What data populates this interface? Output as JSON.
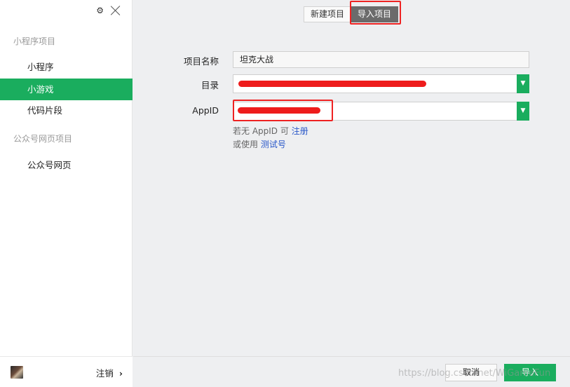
{
  "sidebar": {
    "sections": [
      {
        "label": "小程序项目",
        "items": [
          "小程序",
          "小游戏",
          "代码片段"
        ]
      },
      {
        "label": "公众号网页项目",
        "items": [
          "公众号网页"
        ]
      }
    ],
    "active_item": "小游戏",
    "footer": {
      "logout_label": "注销",
      "chevron": "›"
    }
  },
  "tabs": {
    "new_project": "新建项目",
    "import_project": "导入项目",
    "active": "import_project"
  },
  "form": {
    "name_label": "项目名称",
    "name_value": "坦克大战",
    "dir_label": "目录",
    "appid_label": "AppID",
    "hint1_prefix": "若无 AppID 可",
    "hint1_link": "注册",
    "hint2_prefix": "或使用",
    "hint2_link": "测试号"
  },
  "footer": {
    "cancel_label": "取消",
    "import_label": "导入"
  },
  "watermark": "https://blog.csdn.net/WiGameFun",
  "colors": {
    "accent": "#1aad5e",
    "highlight": "#ee2222",
    "link": "#2a58c9"
  },
  "icons": [
    "gear-icon",
    "close-icon",
    "chevron-down-icon",
    "chevron-right-icon"
  ]
}
